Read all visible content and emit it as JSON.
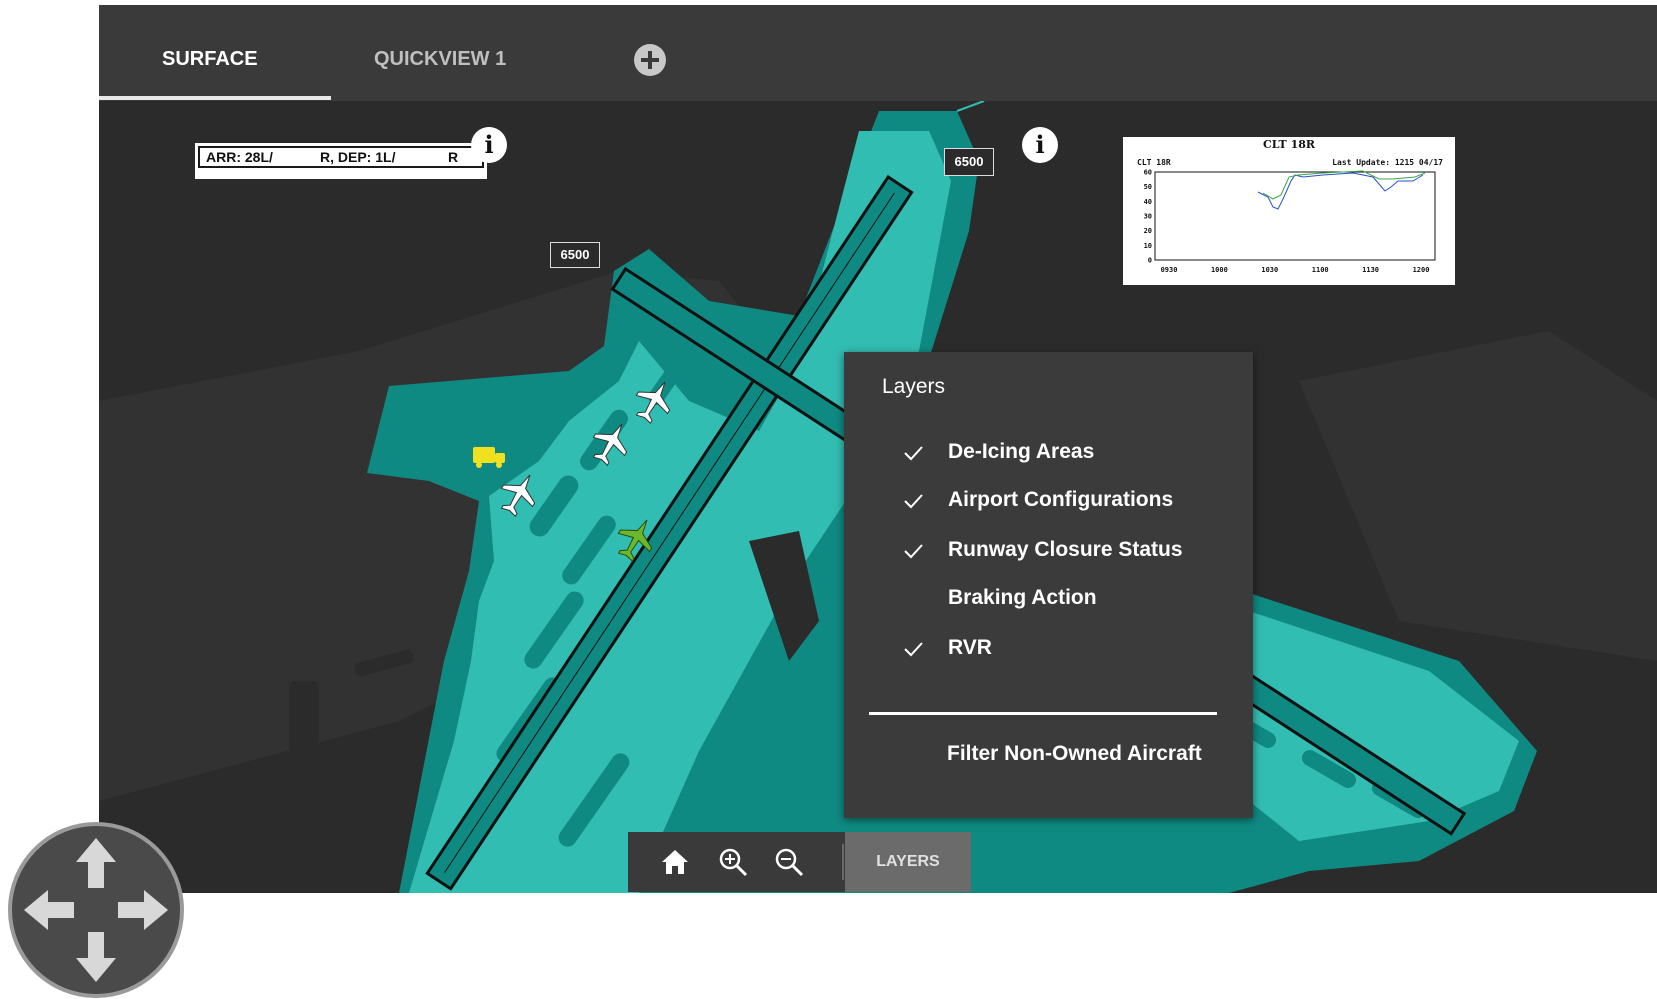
{
  "tabs": [
    {
      "label": "SURFACE",
      "active": true
    },
    {
      "label": "QUICKVIEW 1",
      "active": false
    }
  ],
  "add_tab_icon": "plus-circle-icon",
  "config_box": {
    "arr": "ARR: 28L/",
    "mid": "R, DEP: 1L/",
    "end": "R"
  },
  "altitude_labels": [
    "6500",
    "6500"
  ],
  "rvr_chart": {
    "chart_data": {
      "type": "line",
      "title": "CLT 18R",
      "subtitle_left": "CLT 18R",
      "subtitle_right": "Last Update: 1215 04/17",
      "x_ticks": [
        "0930",
        "1000",
        "1030",
        "1100",
        "1130",
        "1200"
      ],
      "y_ticks": [
        "60",
        "50",
        "40",
        "30",
        "20",
        "10",
        "0"
      ],
      "ylim": [
        0,
        60
      ],
      "series_colors": [
        "#2a4fd0",
        "#3aa84a"
      ]
    }
  },
  "layers_menu": {
    "title": "Layers",
    "items": [
      {
        "label": "De-Icing Areas",
        "checked": true
      },
      {
        "label": "Airport Configurations",
        "checked": true
      },
      {
        "label": "Runway Closure Status",
        "checked": true
      },
      {
        "label": "Braking Action",
        "checked": false
      },
      {
        "label": "RVR",
        "checked": true
      }
    ],
    "filter_label": "Filter Non-Owned Aircraft"
  },
  "toolbar": {
    "home_icon": "home-icon",
    "zoom_in_icon": "zoom-in-icon",
    "zoom_out_icon": "zoom-out-icon",
    "layers_label": "LAYERS"
  },
  "pan_control_icon": "pan-arrows-icon",
  "colors": {
    "runway_area": "#0f8a82",
    "taxiway": "#32bdb2",
    "background": "#2b2b2b",
    "aircraft_owned": "#6bb82a",
    "vehicle": "#f0e020"
  }
}
